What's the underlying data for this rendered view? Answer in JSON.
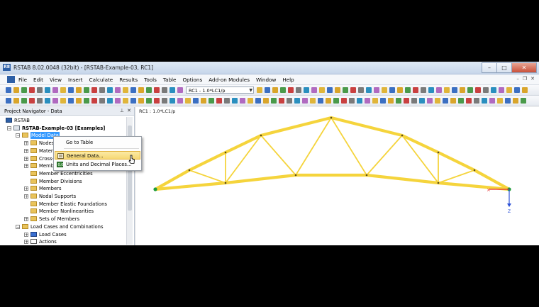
{
  "window": {
    "title": "RSTAB 8.02.0048 (32bit) - [RSTAB-Example-03, RC1]",
    "app_icon_text": "R8"
  },
  "menu": {
    "items": [
      "File",
      "Edit",
      "View",
      "Insert",
      "Calculate",
      "Results",
      "Tools",
      "Table",
      "Options",
      "Add-on Modules",
      "Window",
      "Help"
    ]
  },
  "toolbar": {
    "load_case_combo": "RC1 - 1.0*LC1/p",
    "zoom_combo": ""
  },
  "navigator": {
    "title": "Project Navigator - Data",
    "pin_icon": "pin-icon",
    "tree": [
      {
        "label": "RSTAB",
        "level": 0,
        "expander": "",
        "icon": "app"
      },
      {
        "label": "RSTAB-Example-03 [Examples]",
        "level": 1,
        "expander": "−",
        "icon": "model",
        "bold": true
      },
      {
        "label": "Model Data",
        "level": 2,
        "expander": "−",
        "icon": "folder",
        "selected": true
      },
      {
        "label": "Nodes",
        "level": 3,
        "expander": "+",
        "icon": "folder"
      },
      {
        "label": "Materials",
        "level": 3,
        "expander": "+",
        "icon": "folder"
      },
      {
        "label": "Cross-Sections",
        "level": 3,
        "expander": "+",
        "icon": "folder"
      },
      {
        "label": "Members",
        "level": 3,
        "expander": "+",
        "icon": "folder"
      },
      {
        "label": "Member Eccentricities",
        "level": 3,
        "expander": "",
        "icon": "folder"
      },
      {
        "label": "Member Divisions",
        "level": 3,
        "expander": "",
        "icon": "folder"
      },
      {
        "label": "Members",
        "level": 3,
        "expander": "+",
        "icon": "folder"
      },
      {
        "label": "Nodal Supports",
        "level": 3,
        "expander": "+",
        "icon": "folder"
      },
      {
        "label": "Member Elastic Foundations",
        "level": 3,
        "expander": "",
        "icon": "folder"
      },
      {
        "label": "Member Nonlinearities",
        "level": 3,
        "expander": "",
        "icon": "folder"
      },
      {
        "label": "Sets of Members",
        "level": 3,
        "expander": "+",
        "icon": "folder"
      },
      {
        "label": "Load Cases and Combinations",
        "level": 2,
        "expander": "−",
        "icon": "folder"
      },
      {
        "label": "Load Cases",
        "level": 3,
        "expander": "+",
        "icon": "loadcase"
      },
      {
        "label": "Actions",
        "level": 3,
        "expander": "+",
        "icon": "actions"
      }
    ]
  },
  "context_menu": {
    "items": [
      {
        "label": "Go to Table",
        "icon": "",
        "highlighted": false
      },
      {
        "label": "General Data...",
        "icon": "general-data-icon",
        "highlighted": true
      },
      {
        "label": "Units and Decimal Places...",
        "icon": "units-icon",
        "highlighted": false
      }
    ]
  },
  "view": {
    "label": "RC1 : 1.0*LC1/p",
    "axis_label": "Z",
    "colors": {
      "member": "#f5d43c",
      "member_edge": "#e0b52a",
      "node": "#5a4a1a",
      "support": "#1e9c3a",
      "axis_x": "#e53030",
      "axis_z": "#2a4fd6"
    }
  }
}
